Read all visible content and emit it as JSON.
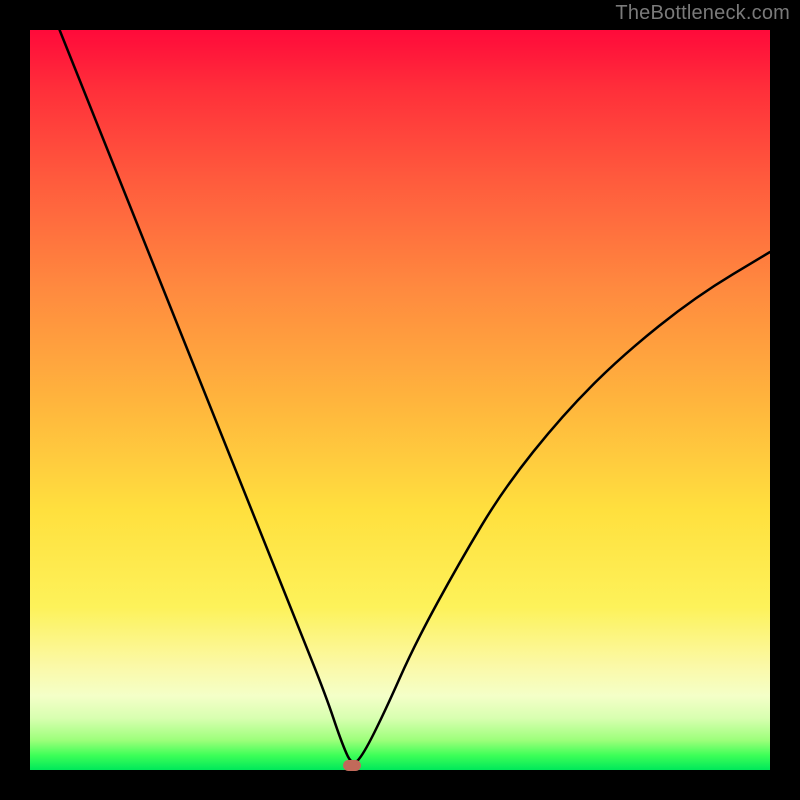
{
  "watermark": "TheBottleneck.com",
  "chart_data": {
    "type": "line",
    "title": "",
    "xlabel": "",
    "ylabel": "",
    "xlim": [
      0,
      100
    ],
    "ylim": [
      0,
      100
    ],
    "series": [
      {
        "name": "bottleneck-curve",
        "x": [
          4,
          8,
          12,
          16,
          20,
          24,
          28,
          32,
          36,
          40,
          42,
          43.5,
          45,
          48,
          52,
          58,
          64,
          72,
          80,
          90,
          100
        ],
        "values": [
          100,
          90,
          80,
          70,
          60,
          50,
          40,
          30,
          20,
          10,
          4,
          0.5,
          2,
          8,
          17,
          28,
          38,
          48,
          56,
          64,
          70
        ]
      }
    ],
    "marker": {
      "x": 43.5,
      "y": 0.5
    },
    "gradient_stops": [
      {
        "pos": 0,
        "color": "#ff0a3a"
      },
      {
        "pos": 50,
        "color": "#ffe03e"
      },
      {
        "pos": 90,
        "color": "#f4ffc8"
      },
      {
        "pos": 100,
        "color": "#00e85a"
      }
    ]
  }
}
